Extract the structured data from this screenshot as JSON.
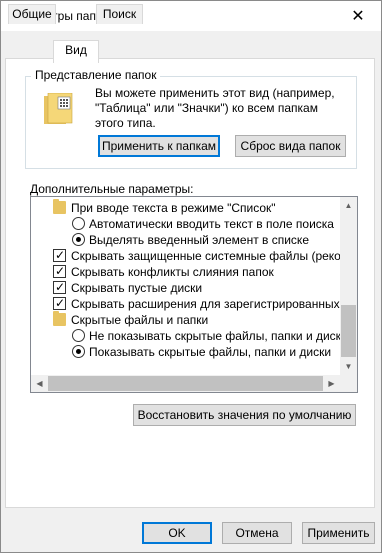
{
  "window": {
    "title": "Параметры папок",
    "close_glyph": "✕"
  },
  "tabs": [
    {
      "label": "Общие"
    },
    {
      "label": "Вид",
      "active": true
    },
    {
      "label": "Поиск"
    }
  ],
  "folder_views": {
    "title": "Представление папок",
    "description": "Вы можете применить этот вид (например, \"Таблица\" или \"Значки\") ко всем папкам этого типа.",
    "apply_label": "Применить к папкам",
    "reset_label": "Сброс вида папок"
  },
  "advanced": {
    "label": "Дополнительные параметры:",
    "items": [
      {
        "type": "folder",
        "text": "При вводе текста в режиме \"Список\""
      },
      {
        "type": "radio",
        "checked": false,
        "text": "Автоматически вводить текст в поле поиска"
      },
      {
        "type": "radio",
        "checked": true,
        "text": "Выделять введенный элемент в списке"
      },
      {
        "type": "checkbox",
        "checked": true,
        "text": "Скрывать защищенные системные файлы (рекомен"
      },
      {
        "type": "checkbox",
        "checked": true,
        "text": "Скрывать конфликты слияния папок"
      },
      {
        "type": "checkbox",
        "checked": true,
        "text": "Скрывать пустые диски"
      },
      {
        "type": "checkbox",
        "checked": true,
        "text": "Скрывать расширения для зарегистрированных типо"
      },
      {
        "type": "folder",
        "text": "Скрытые файлы и папки"
      },
      {
        "type": "radio",
        "checked": false,
        "text": "Не показывать скрытые файлы, папки и диски"
      },
      {
        "type": "radio",
        "checked": true,
        "text": "Показывать скрытые файлы, папки и диски"
      }
    ],
    "restore_label": "Восстановить значения по умолчанию"
  },
  "footer": {
    "ok_label": "OK",
    "cancel_label": "Отмена",
    "apply_label": "Применить"
  },
  "colors": {
    "accent": "#0078d7",
    "folder": "#e8c462"
  }
}
